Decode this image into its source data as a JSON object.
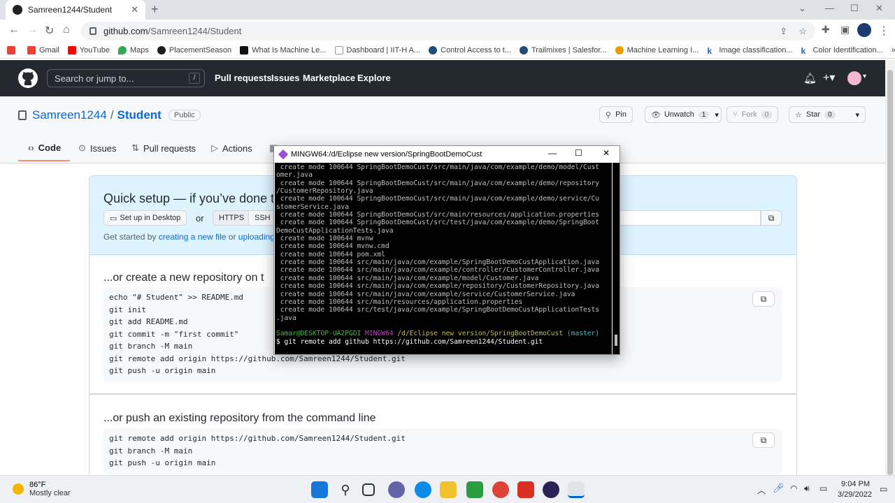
{
  "browser": {
    "tab_title": "Samreen1244/Student",
    "url_host": "github.com",
    "url_path": "/Samreen1244/Student",
    "bookmarks": [
      "Gmail",
      "YouTube",
      "Maps",
      "PlacementSeason",
      "What Is Machine Le...",
      "Dashboard | IIT-H A...",
      "Control Access to t...",
      "Trailmixes | Salesfor...",
      "Machine Learning I...",
      "Image classification...",
      "Color Identification..."
    ]
  },
  "github": {
    "search_placeholder": "Search or jump to...",
    "search_key": "/",
    "nav": [
      "Pull requests",
      "Issues",
      "Marketplace",
      "Explore"
    ]
  },
  "repo": {
    "owner": "Samreen1244",
    "separator": "/",
    "name": "Student",
    "visibility": "Public",
    "pin_label": "Pin",
    "watch_label": "Unwatch",
    "watch_count": "1",
    "fork_label": "Fork",
    "fork_count": "0",
    "star_label": "Star",
    "star_count": "0",
    "tabs": [
      "Code",
      "Issues",
      "Pull requests",
      "Actions"
    ]
  },
  "quick_setup": {
    "heading": "Quick setup — if you’ve done th",
    "desktop_button": "Set up in Desktop",
    "or": "or",
    "https": "HTTPS",
    "ssh": "SSH",
    "get_started_prefix": "Get started by ",
    "link1": "creating a new file",
    "middle": " or ",
    "link2": "uploading"
  },
  "section_new": {
    "heading": "...or create a new repository on t",
    "lines": [
      "echo \"# Student\" >> README.md",
      "git init",
      "git add README.md",
      "git commit -m \"first commit\"",
      "git branch -M main",
      "git remote add origin https://github.com/Samreen1244/Student.git",
      "git push -u origin main"
    ]
  },
  "section_push": {
    "heading": "...or push an existing repository from the command line",
    "lines": [
      "git remote add origin https://github.com/Samreen1244/Student.git",
      "git branch -M main",
      "git push -u origin main"
    ]
  },
  "terminal": {
    "title": "MINGW64:/d/Eclipse new version/SpringBootDemoCust",
    "lines": [
      " create mode 100644 SpringBootDemoCust/src/main/java/com/example/demo/model/Cust",
      "omer.java",
      " create mode 100644 SpringBootDemoCust/src/main/java/com/example/demo/repository",
      "/CustomerRepository.java",
      " create mode 100644 SpringBootDemoCust/src/main/java/com/example/demo/service/Cu",
      "stomerService.java",
      " create mode 100644 SpringBootDemoCust/src/main/resources/application.properties",
      " create mode 100644 SpringBootDemoCust/src/test/java/com/example/demo/SpringBoot",
      "DemoCustApplicationTests.java",
      " create mode 100644 mvnw",
      " create mode 100644 mvnw.cmd",
      " create mode 100644 pom.xml",
      " create mode 100644 src/main/java/com/example/SpringBootDemoCustApplication.java",
      " create mode 100644 src/main/java/com/example/controller/CustomerController.java",
      " create mode 100644 src/main/java/com/example/model/Customer.java",
      " create mode 100644 src/main/java/com/example/repository/CustomerRepository.java",
      " create mode 100644 src/main/java/com/example/service/CustomerService.java",
      " create mode 100644 src/main/resources/application.properties",
      " create mode 100644 src/test/java/com/example/SpringBootDemoCustApplicationTests",
      ".java"
    ],
    "prompt_user": "Samar@DESKTOP-UA2PGDI",
    "prompt_env": "MINGW64",
    "prompt_path": "/d/Eclipse new version/SpringBootDemoCust",
    "prompt_branch": "(master)",
    "command": "$ git remote add github https://github.com/Samreen1244/Student.git"
  },
  "taskbar": {
    "temp": "86°F",
    "weather": "Mostly clear",
    "time": "9:04 PM",
    "date": "3/29/2022"
  }
}
